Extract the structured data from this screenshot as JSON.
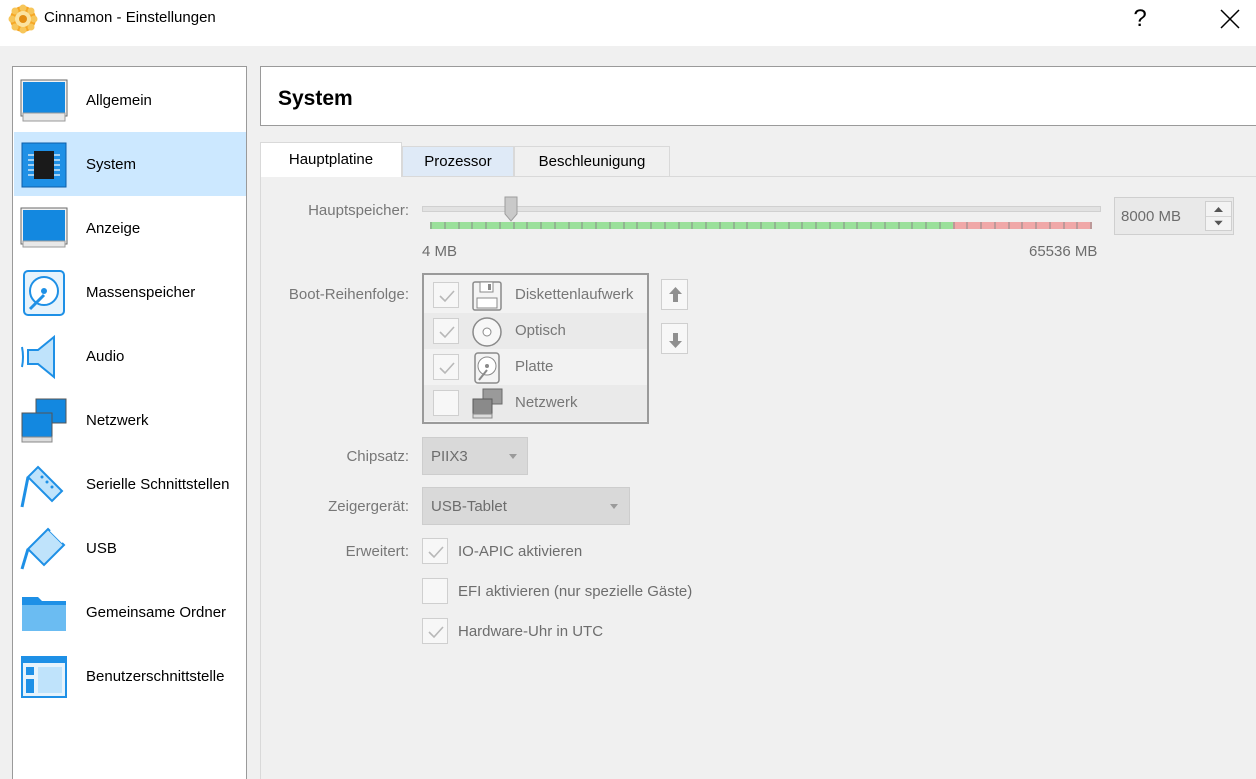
{
  "window": {
    "title": "Cinnamon - Einstellungen",
    "help_label": "?"
  },
  "sidebar": {
    "items": [
      {
        "label": "Allgemein",
        "icon": "general-monitor-icon"
      },
      {
        "label": "System",
        "icon": "system-chip-icon",
        "selected": true
      },
      {
        "label": "Anzeige",
        "icon": "display-monitor-icon"
      },
      {
        "label": "Massenspeicher",
        "icon": "storage-disk-icon"
      },
      {
        "label": "Audio",
        "icon": "speaker-icon"
      },
      {
        "label": "Netzwerk",
        "icon": "network-icon"
      },
      {
        "label": "Serielle Schnittstellen",
        "icon": "serial-cable-icon"
      },
      {
        "label": "USB",
        "icon": "usb-icon"
      },
      {
        "label": "Gemeinsame Ordner",
        "icon": "folder-icon"
      },
      {
        "label": "Benutzerschnittstelle",
        "icon": "ui-window-icon"
      }
    ]
  },
  "header": {
    "title": "System"
  },
  "tabs": [
    {
      "label": "Hauptplatine",
      "active": true
    },
    {
      "label": "Prozessor"
    },
    {
      "label": "Beschleunigung"
    }
  ],
  "motherboard": {
    "memory": {
      "label": "Hauptspeicher:",
      "value": 8000,
      "value_text": "8000 MB",
      "min": 4,
      "max": 65536,
      "min_label": "4 MB",
      "max_label": "65536 MB"
    },
    "boot_order": {
      "label": "Boot-Reihenfolge:",
      "items": [
        {
          "label": "Diskettenlaufwerk",
          "checked": true,
          "icon": "floppy-icon"
        },
        {
          "label": "Optisch",
          "checked": true,
          "icon": "optical-disc-icon"
        },
        {
          "label": "Platte",
          "checked": true,
          "icon": "hard-disk-icon"
        },
        {
          "label": "Netzwerk",
          "checked": false,
          "icon": "network-icon"
        }
      ]
    },
    "chipset": {
      "label": "Chipsatz:",
      "value": "PIIX3"
    },
    "pointing_device": {
      "label": "Zeigergerät:",
      "value": "USB-Tablet"
    },
    "extended": {
      "label": "Erweitert:",
      "options": [
        {
          "label": "IO-APIC aktivieren",
          "checked": true
        },
        {
          "label": "EFI aktivieren (nur spezielle Gäste)",
          "checked": false
        },
        {
          "label": "Hardware-Uhr in UTC",
          "checked": true
        }
      ]
    }
  },
  "colors": {
    "accent": "#1e90e6",
    "selection": "#cce8ff",
    "tick_green": "#9be09b",
    "tick_red": "#f0a8a8"
  }
}
